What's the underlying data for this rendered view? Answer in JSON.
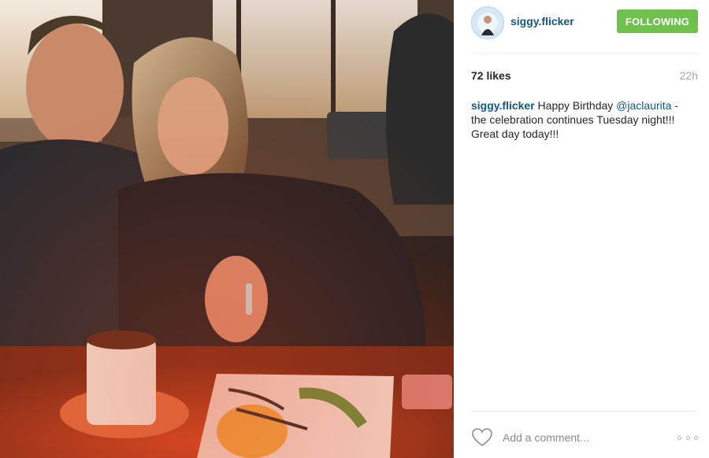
{
  "post": {
    "author": {
      "username": "siggy.flicker",
      "avatar_icon": "profile-avatar"
    },
    "follow_button_label": "FOLLOWING",
    "likes_text": "72 likes",
    "time_ago": "22h",
    "caption": {
      "username": "siggy.flicker",
      "text_before": " Happy Birthday ",
      "mention": "@jaclaurita",
      "text_after": " - the celebration continues Tuesday night!!! Great day today!!!"
    },
    "comment_box": {
      "placeholder": "Add a comment...",
      "like_icon": "heart-icon",
      "more_icon": "more-options-icon"
    }
  },
  "colors": {
    "follow_green": "#70c050",
    "link_blue": "#125688",
    "muted_gray": "#a5a7aa"
  }
}
